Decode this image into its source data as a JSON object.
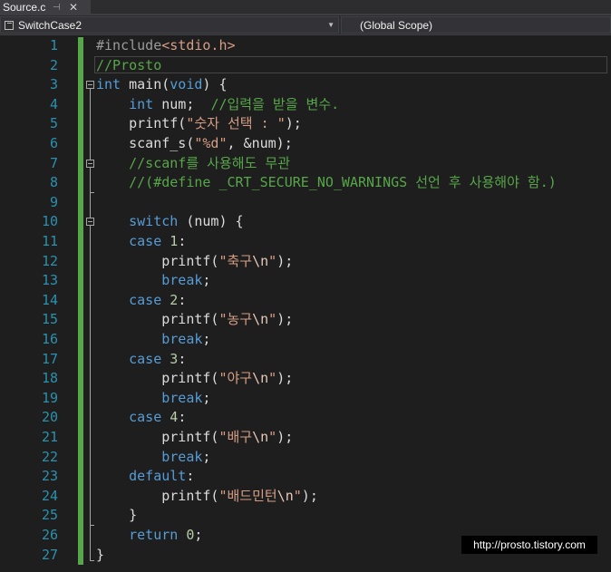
{
  "tab": {
    "filename": "Source.c",
    "pin_glyph": "⊣",
    "close_glyph": "✕"
  },
  "navbar": {
    "project": "SwitchCase2",
    "scope": "(Global Scope)"
  },
  "code_lines": [
    {
      "num": "1",
      "parts": [
        {
          "t": "#include",
          "c": "pp"
        },
        {
          "t": "<stdio.h>",
          "c": "str"
        }
      ]
    },
    {
      "num": "2",
      "parts": [
        {
          "t": "//Prosto",
          "c": "cm"
        }
      ]
    },
    {
      "num": "3",
      "parts": [
        {
          "t": "int",
          "c": "kw"
        },
        {
          "t": " main(",
          "c": ""
        },
        {
          "t": "void",
          "c": "kw"
        },
        {
          "t": ") {",
          "c": ""
        }
      ]
    },
    {
      "num": "4",
      "parts": [
        {
          "t": "    ",
          "c": ""
        },
        {
          "t": "int",
          "c": "kw"
        },
        {
          "t": " num;  ",
          "c": ""
        },
        {
          "t": "//입력을 받을 변수.",
          "c": "cm"
        }
      ]
    },
    {
      "num": "5",
      "parts": [
        {
          "t": "    printf(",
          "c": ""
        },
        {
          "t": "\"숫자 선택 : \"",
          "c": "str"
        },
        {
          "t": ");",
          "c": ""
        }
      ]
    },
    {
      "num": "6",
      "parts": [
        {
          "t": "    scanf_s(",
          "c": ""
        },
        {
          "t": "\"%d\"",
          "c": "str"
        },
        {
          "t": ", &num);",
          "c": ""
        }
      ]
    },
    {
      "num": "7",
      "parts": [
        {
          "t": "    ",
          "c": ""
        },
        {
          "t": "//scanf를 사용해도 무관",
          "c": "cm"
        }
      ]
    },
    {
      "num": "8",
      "parts": [
        {
          "t": "    ",
          "c": ""
        },
        {
          "t": "//(#define _CRT_SECURE_NO_WARNINGS 선언 후 사용해야 함.)",
          "c": "cm"
        }
      ]
    },
    {
      "num": "9",
      "parts": []
    },
    {
      "num": "10",
      "parts": [
        {
          "t": "    ",
          "c": ""
        },
        {
          "t": "switch",
          "c": "kw"
        },
        {
          "t": " (num) {",
          "c": ""
        }
      ]
    },
    {
      "num": "11",
      "parts": [
        {
          "t": "    ",
          "c": ""
        },
        {
          "t": "case",
          "c": "kw"
        },
        {
          "t": " ",
          "c": ""
        },
        {
          "t": "1",
          "c": "num"
        },
        {
          "t": ":",
          "c": ""
        }
      ]
    },
    {
      "num": "12",
      "parts": [
        {
          "t": "        printf(",
          "c": ""
        },
        {
          "t": "\"축구",
          "c": "str"
        },
        {
          "t": "\\n",
          "c": "esc"
        },
        {
          "t": "\"",
          "c": "str"
        },
        {
          "t": ");",
          "c": ""
        }
      ]
    },
    {
      "num": "13",
      "parts": [
        {
          "t": "        ",
          "c": ""
        },
        {
          "t": "break",
          "c": "kw"
        },
        {
          "t": ";",
          "c": ""
        }
      ]
    },
    {
      "num": "14",
      "parts": [
        {
          "t": "    ",
          "c": ""
        },
        {
          "t": "case",
          "c": "kw"
        },
        {
          "t": " ",
          "c": ""
        },
        {
          "t": "2",
          "c": "num"
        },
        {
          "t": ":",
          "c": ""
        }
      ]
    },
    {
      "num": "15",
      "parts": [
        {
          "t": "        printf(",
          "c": ""
        },
        {
          "t": "\"농구",
          "c": "str"
        },
        {
          "t": "\\n",
          "c": "esc"
        },
        {
          "t": "\"",
          "c": "str"
        },
        {
          "t": ");",
          "c": ""
        }
      ]
    },
    {
      "num": "16",
      "parts": [
        {
          "t": "        ",
          "c": ""
        },
        {
          "t": "break",
          "c": "kw"
        },
        {
          "t": ";",
          "c": ""
        }
      ]
    },
    {
      "num": "17",
      "parts": [
        {
          "t": "    ",
          "c": ""
        },
        {
          "t": "case",
          "c": "kw"
        },
        {
          "t": " ",
          "c": ""
        },
        {
          "t": "3",
          "c": "num"
        },
        {
          "t": ":",
          "c": ""
        }
      ]
    },
    {
      "num": "18",
      "parts": [
        {
          "t": "        printf(",
          "c": ""
        },
        {
          "t": "\"야구",
          "c": "str"
        },
        {
          "t": "\\n",
          "c": "esc"
        },
        {
          "t": "\"",
          "c": "str"
        },
        {
          "t": ");",
          "c": ""
        }
      ]
    },
    {
      "num": "19",
      "parts": [
        {
          "t": "        ",
          "c": ""
        },
        {
          "t": "break",
          "c": "kw"
        },
        {
          "t": ";",
          "c": ""
        }
      ]
    },
    {
      "num": "20",
      "parts": [
        {
          "t": "    ",
          "c": ""
        },
        {
          "t": "case",
          "c": "kw"
        },
        {
          "t": " ",
          "c": ""
        },
        {
          "t": "4",
          "c": "num"
        },
        {
          "t": ":",
          "c": ""
        }
      ]
    },
    {
      "num": "21",
      "parts": [
        {
          "t": "        printf(",
          "c": ""
        },
        {
          "t": "\"배구",
          "c": "str"
        },
        {
          "t": "\\n",
          "c": "esc"
        },
        {
          "t": "\"",
          "c": "str"
        },
        {
          "t": ");",
          "c": ""
        }
      ]
    },
    {
      "num": "22",
      "parts": [
        {
          "t": "        ",
          "c": ""
        },
        {
          "t": "break",
          "c": "kw"
        },
        {
          "t": ";",
          "c": ""
        }
      ]
    },
    {
      "num": "23",
      "parts": [
        {
          "t": "    ",
          "c": ""
        },
        {
          "t": "default",
          "c": "kw"
        },
        {
          "t": ":",
          "c": ""
        }
      ]
    },
    {
      "num": "24",
      "parts": [
        {
          "t": "        printf(",
          "c": ""
        },
        {
          "t": "\"배드민턴",
          "c": "str"
        },
        {
          "t": "\\n",
          "c": "esc"
        },
        {
          "t": "\"",
          "c": "str"
        },
        {
          "t": ");",
          "c": ""
        }
      ]
    },
    {
      "num": "25",
      "parts": [
        {
          "t": "    }",
          "c": ""
        }
      ]
    },
    {
      "num": "26",
      "parts": [
        {
          "t": "    ",
          "c": ""
        },
        {
          "t": "return",
          "c": "kw"
        },
        {
          "t": " ",
          "c": ""
        },
        {
          "t": "0",
          "c": "num"
        },
        {
          "t": ";",
          "c": ""
        }
      ]
    },
    {
      "num": "27",
      "parts": [
        {
          "t": "}",
          "c": ""
        }
      ]
    }
  ],
  "watermark": "http://prosto.tistory.com",
  "colors": {
    "background": "#1e1e1e",
    "line_number": "#2b91af",
    "keyword": "#569cd6",
    "string": "#d69d85",
    "comment": "#57a64a",
    "preprocessor": "#9b9b9b",
    "number": "#b5cea8",
    "change_bar": "#57a64a"
  }
}
